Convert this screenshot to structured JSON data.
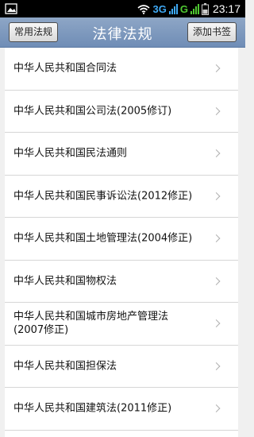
{
  "status_bar": {
    "network_3g": "3G",
    "network_g": "G",
    "time": "23:17",
    "icons": [
      "image-icon",
      "wifi-icon",
      "signal-icon",
      "battery-icon"
    ]
  },
  "header": {
    "left_button": "常用法规",
    "title": "法律法规",
    "right_button": "添加书签"
  },
  "list": {
    "items": [
      {
        "label": "中华人民共和国合同法"
      },
      {
        "label": "中华人民共和国公司法(2005修订)"
      },
      {
        "label": "中华人民共和国民法通则"
      },
      {
        "label": "中华人民共和国民事诉讼法(2012修正)"
      },
      {
        "label": "中华人民共和国土地管理法(2004修正)"
      },
      {
        "label": "中华人民共和国物权法"
      },
      {
        "label": "中华人民共和国城市房地产管理法(2007修正)"
      },
      {
        "label": "中华人民共和国担保法"
      },
      {
        "label": "中华人民共和国建筑法(2011修正)"
      }
    ]
  }
}
